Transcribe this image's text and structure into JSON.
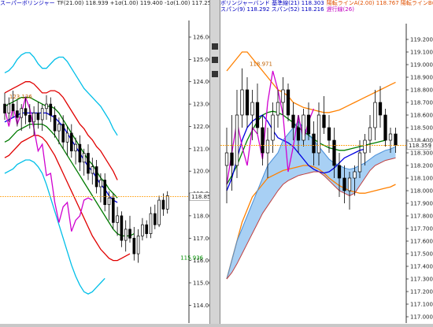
{
  "left_chart": {
    "header": {
      "title": "スーパーボリンジャー",
      "params": "TF(21.00)  118.939  +1σ(1.00)  119.400  -1σ(1.00)  117.257  +2σ(2.00)  120.471  -2σ(2.0)"
    },
    "current_price_label": "118.859",
    "low_label": "115.936",
    "high_label": "123.136"
  },
  "right_chart": {
    "header": {
      "line1_a": "ボリンジャーバンド  基準線(21)  118.303",
      "line1_b": "陽転ラインA(2.00)  118.767  陽転ラインB(2.00)  117.838",
      "line2_a": "スパン(9)  118.292  スパン(52)  118.216",
      "line2_b": "遅行線(26)"
    },
    "current_price_label": "118.359",
    "high_label_1": "118.971",
    "high_label_2": "118.322",
    "low_label": "117.955"
  },
  "chart_data": [
    {
      "type": "candlestick",
      "name": "left",
      "ylim": [
        113.8,
        126.6
      ],
      "y_ticks": [
        114.0,
        115.0,
        116.0,
        117.0,
        118.0,
        119.0,
        120.0,
        121.0,
        122.0,
        123.0,
        124.0,
        125.0,
        126.0
      ],
      "current_price": 118.859,
      "annotations": [
        {
          "text": "123.136",
          "x": 3,
          "y": 123.136
        },
        {
          "text": "115.936",
          "x": 44,
          "y": 115.936
        }
      ],
      "candles": [
        [
          123.0,
          123.5,
          122.3,
          122.6
        ],
        [
          122.6,
          123.3,
          122.2,
          123.0
        ],
        [
          123.0,
          123.6,
          122.4,
          122.7
        ],
        [
          122.7,
          123.2,
          122.0,
          122.4
        ],
        [
          122.4,
          123.0,
          121.8,
          122.8
        ],
        [
          122.8,
          123.3,
          122.1,
          122.5
        ],
        [
          122.5,
          123.0,
          121.9,
          122.2
        ],
        [
          122.2,
          122.9,
          121.6,
          122.6
        ],
        [
          122.6,
          123.1,
          121.9,
          122.3
        ],
        [
          122.3,
          123.0,
          121.8,
          122.8
        ],
        [
          122.8,
          123.4,
          122.3,
          123.0
        ],
        [
          123.0,
          123.3,
          122.2,
          122.5
        ],
        [
          122.5,
          122.9,
          121.5,
          121.8
        ],
        [
          121.8,
          122.4,
          121.2,
          122.1
        ],
        [
          122.1,
          122.5,
          121.0,
          121.3
        ],
        [
          121.3,
          122.0,
          120.7,
          121.7
        ],
        [
          121.7,
          122.1,
          120.6,
          120.9
        ],
        [
          120.9,
          121.5,
          120.3,
          121.2
        ],
        [
          121.2,
          121.6,
          120.0,
          120.4
        ],
        [
          120.4,
          121.0,
          119.8,
          120.8
        ],
        [
          120.8,
          121.2,
          119.6,
          119.9
        ],
        [
          119.9,
          120.6,
          119.4,
          120.2
        ],
        [
          120.2,
          120.5,
          119.0,
          119.3
        ],
        [
          119.3,
          119.9,
          118.6,
          119.6
        ],
        [
          119.6,
          119.9,
          118.2,
          118.5
        ],
        [
          118.5,
          119.1,
          117.8,
          118.8
        ],
        [
          118.8,
          119.0,
          117.4,
          117.7
        ],
        [
          117.7,
          118.4,
          117.1,
          118.0
        ],
        [
          118.0,
          118.2,
          116.6,
          116.9
        ],
        [
          116.9,
          117.8,
          116.4,
          117.4
        ],
        [
          117.4,
          118.0,
          116.8,
          117.0
        ],
        [
          117.0,
          117.5,
          116.0,
          116.3
        ],
        [
          116.3,
          117.4,
          115.9,
          117.1
        ],
        [
          117.1,
          117.9,
          116.9,
          117.6
        ],
        [
          117.6,
          117.8,
          117.0,
          117.2
        ],
        [
          117.2,
          118.4,
          117.0,
          118.1
        ],
        [
          118.1,
          118.5,
          117.4,
          117.6
        ],
        [
          117.6,
          118.9,
          117.5,
          118.7
        ],
        [
          118.7,
          119.0,
          118.0,
          118.3
        ],
        [
          118.3,
          119.1,
          118.1,
          118.9
        ]
      ],
      "series": [
        {
          "role": "+2sigma",
          "color": "#00bfe8",
          "values": [
            124.4,
            124.5,
            124.7,
            125.0,
            125.2,
            125.3,
            125.3,
            125.1,
            124.8,
            124.6,
            124.6,
            124.8,
            125.0,
            125.1,
            125.1,
            124.9,
            124.6,
            124.3,
            124.0,
            123.7,
            123.5,
            123.3,
            123.1,
            122.9,
            122.6,
            122.3,
            121.9,
            121.6
          ]
        },
        {
          "role": "+1sigma",
          "color": "#e00000",
          "values": [
            123.5,
            123.6,
            123.7,
            123.8,
            123.9,
            124.0,
            124.0,
            123.9,
            123.7,
            123.5,
            123.5,
            123.6,
            123.6,
            123.5,
            123.3,
            123.0,
            122.7,
            122.4,
            122.1,
            121.9,
            121.6,
            121.4,
            121.1,
            120.9,
            120.6,
            120.3,
            120.0,
            119.6
          ]
        },
        {
          "role": "+0.5sigma",
          "color": "#007a00",
          "values": [
            122.9,
            123.0,
            123.1,
            123.2,
            123.3,
            123.3,
            123.3,
            123.2,
            123.1,
            123.0,
            122.9,
            122.9,
            122.8,
            122.6,
            122.3,
            122.0,
            121.7,
            121.4,
            121.1,
            120.8,
            120.5,
            120.3,
            120.0,
            119.7,
            119.5,
            119.2,
            119.0,
            118.8
          ]
        },
        {
          "role": "middle",
          "color": "#0000e0",
          "values": [
            122.2,
            122.3,
            122.4,
            122.5,
            122.6,
            122.6,
            122.6,
            122.6,
            122.6,
            122.6,
            122.6,
            122.5,
            122.4,
            122.2,
            122.0,
            121.7,
            121.4,
            121.1,
            120.8,
            120.5,
            120.2,
            120.0,
            119.7,
            119.4,
            119.2,
            118.9,
            118.7,
            118.6
          ]
        },
        {
          "role": "-0.5sigma",
          "color": "#007a00",
          "values": [
            121.3,
            121.4,
            121.6,
            121.8,
            121.9,
            122.0,
            122.1,
            122.1,
            122.1,
            122.1,
            122.0,
            121.8,
            121.6,
            121.3,
            121.0,
            120.7,
            120.4,
            120.1,
            119.8,
            119.5,
            119.2,
            118.9,
            118.6,
            118.3,
            118.0,
            117.7,
            117.4,
            117.2,
            117.1,
            117.1,
            117.1,
            117.2
          ]
        },
        {
          "role": "-1sigma",
          "color": "#e00000",
          "values": [
            120.6,
            120.7,
            120.9,
            121.1,
            121.3,
            121.4,
            121.5,
            121.6,
            121.6,
            121.5,
            121.3,
            121.0,
            120.7,
            120.3,
            119.9,
            119.5,
            119.1,
            118.7,
            118.3,
            117.9,
            117.5,
            117.1,
            116.8,
            116.5,
            116.3,
            116.1,
            116.0,
            116.0,
            116.1,
            116.2,
            116.3
          ]
        },
        {
          "role": "-2sigma",
          "color": "#00bfe8",
          "values": [
            119.9,
            120.0,
            120.1,
            120.3,
            120.4,
            120.5,
            120.5,
            120.4,
            120.2,
            119.9,
            119.4,
            118.8,
            118.2,
            117.6,
            117.0,
            116.4,
            115.8,
            115.3,
            114.9,
            114.6,
            114.5,
            114.6,
            114.8,
            115.0,
            115.2
          ]
        },
        {
          "role": "lagging-span",
          "color": "#d000d0",
          "values": [
            122.8,
            122.0,
            122.9,
            122.1,
            122.6,
            123.3,
            122.8,
            121.9,
            120.9,
            121.2,
            119.8,
            119.9,
            118.6,
            117.7,
            118.4,
            118.6,
            117.3,
            117.8,
            118.0,
            118.7,
            118.8,
            118.7
          ]
        }
      ]
    },
    {
      "type": "candlestick",
      "name": "right",
      "ylim": [
        116.95,
        119.3
      ],
      "y_ticks": [
        117.0,
        117.1,
        117.2,
        117.3,
        117.4,
        117.5,
        117.6,
        117.7,
        117.8,
        117.9,
        118.0,
        118.1,
        118.2,
        118.3,
        118.4,
        118.5,
        118.6,
        118.7,
        118.8,
        118.9,
        119.0,
        119.1,
        119.2
      ],
      "current_price": 118.359,
      "annotations": [
        {
          "text": "118.971",
          "x": 6,
          "y": 118.971
        },
        {
          "text": "118.322",
          "x": 54,
          "y": 118.83
        },
        {
          "text": "117.955",
          "x": 44,
          "y": 117.78
        }
      ],
      "candles": [
        [
          118.2,
          118.5,
          117.9,
          118.3
        ],
        [
          118.3,
          118.6,
          118.0,
          118.2
        ],
        [
          118.2,
          118.8,
          118.1,
          118.6
        ],
        [
          118.6,
          118.97,
          118.5,
          118.8
        ],
        [
          118.8,
          118.9,
          118.5,
          118.6
        ],
        [
          118.6,
          118.8,
          118.4,
          118.7
        ],
        [
          118.7,
          118.85,
          118.45,
          118.5
        ],
        [
          118.5,
          118.6,
          118.2,
          118.3
        ],
        [
          118.3,
          118.5,
          118.1,
          118.4
        ],
        [
          118.4,
          118.7,
          118.3,
          118.6
        ],
        [
          118.6,
          118.8,
          118.5,
          118.7
        ],
        [
          118.7,
          118.9,
          118.6,
          118.8
        ],
        [
          118.8,
          118.85,
          118.55,
          118.6
        ],
        [
          118.6,
          118.7,
          118.4,
          118.5
        ],
        [
          118.5,
          118.6,
          118.3,
          118.4
        ],
        [
          118.4,
          118.65,
          118.35,
          118.6
        ],
        [
          118.6,
          118.7,
          118.4,
          118.45
        ],
        [
          118.45,
          118.55,
          118.2,
          118.3
        ],
        [
          118.3,
          118.7,
          118.2,
          118.6
        ],
        [
          118.6,
          118.75,
          118.45,
          118.5
        ],
        [
          118.5,
          118.6,
          118.3,
          118.4
        ],
        [
          118.4,
          118.5,
          118.1,
          118.2
        ],
        [
          118.2,
          118.3,
          117.95,
          118.1
        ],
        [
          118.1,
          118.2,
          117.9,
          118.0
        ],
        [
          118.0,
          118.15,
          117.85,
          118.1
        ],
        [
          118.1,
          118.2,
          117.96,
          118.15
        ],
        [
          118.15,
          118.4,
          118.1,
          118.3
        ],
        [
          118.3,
          118.45,
          118.2,
          118.4
        ],
        [
          118.4,
          118.6,
          118.3,
          118.5
        ],
        [
          118.5,
          118.8,
          118.4,
          118.7
        ],
        [
          118.7,
          118.83,
          118.5,
          118.6
        ],
        [
          118.6,
          118.65,
          118.35,
          118.4
        ],
        [
          118.4,
          118.5,
          118.3,
          118.45
        ],
        [
          118.45,
          118.5,
          118.3,
          118.36
        ]
      ],
      "series": [
        {
          "role": "bollinger-upper",
          "color": "#ff8000",
          "values": [
            118.95,
            119.0,
            119.05,
            119.1,
            119.1,
            119.05,
            119.0,
            118.95,
            118.9,
            118.85,
            118.8,
            118.78,
            118.75,
            118.7,
            118.68,
            118.66,
            118.65,
            118.64,
            118.63,
            118.62,
            118.62,
            118.63,
            118.64,
            118.66,
            118.68,
            118.7,
            118.72,
            118.74,
            118.76,
            118.78,
            118.8,
            118.82,
            118.84,
            118.86
          ]
        },
        {
          "role": "bollinger-lower",
          "color": "#ff8000",
          "values": [
            117.3,
            117.45,
            117.6,
            117.75,
            117.85,
            117.95,
            118.0,
            118.05,
            118.1,
            118.12,
            118.14,
            118.16,
            118.17,
            118.18,
            118.19,
            118.2,
            118.2,
            118.19,
            118.17,
            118.14,
            118.1,
            118.07,
            118.04,
            118.02,
            118.0,
            117.99,
            117.98,
            117.98,
            117.99,
            118.0,
            118.01,
            118.02,
            118.03,
            118.05
          ]
        },
        {
          "role": "kijun",
          "color": "#008000",
          "values": [
            118.05,
            118.12,
            118.2,
            118.3,
            118.4,
            118.48,
            118.55,
            118.6,
            118.62,
            118.63,
            118.62,
            118.6,
            118.57,
            118.54,
            118.5,
            118.47,
            118.44,
            118.41,
            118.38,
            118.36,
            118.34,
            118.33,
            118.32,
            118.32,
            118.33,
            118.34,
            118.35,
            118.36,
            118.37,
            118.38,
            118.39,
            118.4
          ]
        },
        {
          "role": "tenkan",
          "color": "#0000e0",
          "values": [
            118.0,
            118.1,
            118.25,
            118.4,
            118.5,
            118.55,
            118.58,
            118.6,
            118.55,
            118.48,
            118.42,
            118.4,
            118.38,
            118.35,
            118.3,
            118.25,
            118.2,
            118.17,
            118.15,
            118.14,
            118.15,
            118.18,
            118.22,
            118.26,
            118.28,
            118.3,
            118.32,
            118.33
          ]
        },
        {
          "role": "cloud-span-a",
          "color": "#4a90d9",
          "values": [
            117.3,
            117.45,
            117.6,
            117.7,
            117.8,
            117.9,
            118.0,
            118.1,
            118.2,
            118.25,
            118.3,
            118.4,
            118.45,
            118.5,
            118.55,
            118.5,
            118.45,
            118.4,
            118.35,
            118.3,
            118.25,
            118.22,
            118.2,
            118.18,
            118.17,
            118.18,
            118.2,
            118.22,
            118.25,
            118.28,
            118.3,
            118.32,
            118.33,
            118.35
          ]
        },
        {
          "role": "cloud-span-b",
          "color": "#c04040",
          "values": [
            117.3,
            117.35,
            117.42,
            117.5,
            117.58,
            117.66,
            117.74,
            117.82,
            117.88,
            117.94,
            118.0,
            118.05,
            118.08,
            118.1,
            118.12,
            118.13,
            118.14,
            118.15,
            118.15,
            118.12,
            118.08,
            118.04,
            118.0,
            117.98,
            117.96,
            117.98,
            118.04,
            118.1,
            118.16,
            118.2,
            118.22,
            118.24,
            118.25,
            118.26
          ]
        },
        {
          "role": "lagging-span",
          "color": "#d000d0",
          "values": [
            118.05,
            118.3,
            118.55,
            118.35,
            118.2,
            118.5,
            118.45,
            118.25,
            118.7,
            118.95,
            118.8,
            118.6,
            118.15,
            118.35,
            118.6,
            118.4,
            118.55,
            118.65
          ]
        }
      ]
    }
  ]
}
